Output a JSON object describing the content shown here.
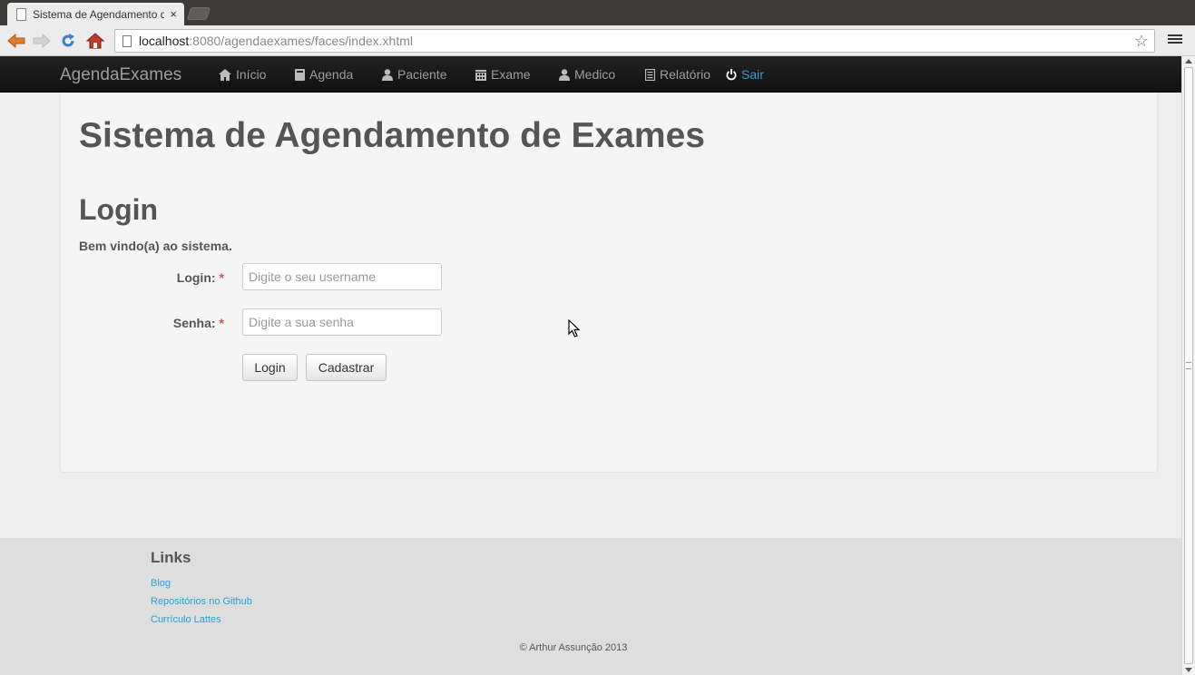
{
  "browser": {
    "tab_title": "Sistema de Agendamento de Exames",
    "tab_close": "×",
    "url_host": "localhost",
    "url_rest": ":8080/agendaexames/faces/index.xhtml",
    "star_icon": "☆"
  },
  "navbar": {
    "brand": "AgendaExames",
    "items": [
      {
        "label": "Início",
        "icon": "home-icon"
      },
      {
        "label": "Agenda",
        "icon": "book-icon"
      },
      {
        "label": "Paciente",
        "icon": "user-icon"
      },
      {
        "label": "Exame",
        "icon": "calendar-icon"
      },
      {
        "label": "Medico",
        "icon": "user-icon"
      },
      {
        "label": "Relatório",
        "icon": "list-alt-icon"
      },
      {
        "label": "Sair",
        "icon": "off-icon"
      }
    ],
    "sair_color": "#2a9fd6"
  },
  "main": {
    "title": "Sistema de Agendamento de Exames",
    "section_title": "Login",
    "welcome": "Bem vindo(a) ao sistema.",
    "login_label": "Login:",
    "login_placeholder": "Digite o seu username",
    "login_value": "",
    "senha_label": "Senha:",
    "senha_placeholder": "Digite a sua senha",
    "senha_value": "",
    "required_mark": "*",
    "login_button": "Login",
    "cadastrar_button": "Cadastrar"
  },
  "footer": {
    "links_title": "Links",
    "links": [
      "Blog",
      "Repositórios no Github",
      "Currículo Lattes"
    ],
    "copyright": "© Arthur Assunção 2013"
  },
  "colors": {
    "navbar_bg": "#161616",
    "link": "#2a9fd6",
    "heading": "#555555",
    "required": "#d9534f"
  }
}
